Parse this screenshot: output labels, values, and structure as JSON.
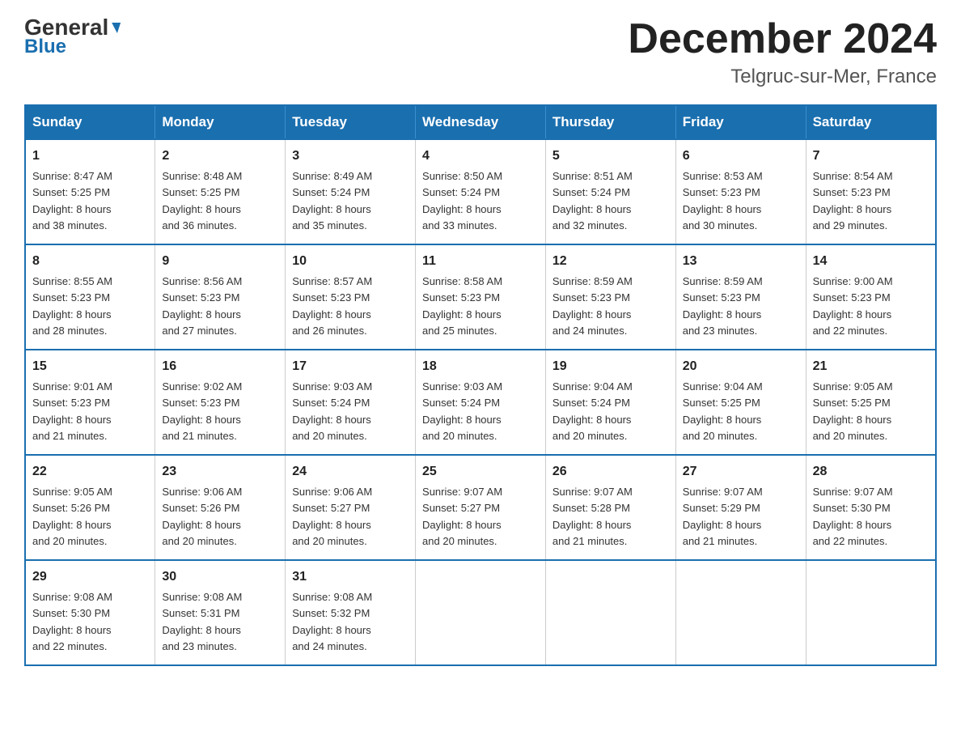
{
  "logo": {
    "part1": "General",
    "part2": "Blue"
  },
  "header": {
    "month_year": "December 2024",
    "location": "Telgruc-sur-Mer, France"
  },
  "days_of_week": [
    "Sunday",
    "Monday",
    "Tuesday",
    "Wednesday",
    "Thursday",
    "Friday",
    "Saturday"
  ],
  "weeks": [
    [
      {
        "day": "1",
        "sunrise": "8:47 AM",
        "sunset": "5:25 PM",
        "daylight": "8 hours and 38 minutes."
      },
      {
        "day": "2",
        "sunrise": "8:48 AM",
        "sunset": "5:25 PM",
        "daylight": "8 hours and 36 minutes."
      },
      {
        "day": "3",
        "sunrise": "8:49 AM",
        "sunset": "5:24 PM",
        "daylight": "8 hours and 35 minutes."
      },
      {
        "day": "4",
        "sunrise": "8:50 AM",
        "sunset": "5:24 PM",
        "daylight": "8 hours and 33 minutes."
      },
      {
        "day": "5",
        "sunrise": "8:51 AM",
        "sunset": "5:24 PM",
        "daylight": "8 hours and 32 minutes."
      },
      {
        "day": "6",
        "sunrise": "8:53 AM",
        "sunset": "5:23 PM",
        "daylight": "8 hours and 30 minutes."
      },
      {
        "day": "7",
        "sunrise": "8:54 AM",
        "sunset": "5:23 PM",
        "daylight": "8 hours and 29 minutes."
      }
    ],
    [
      {
        "day": "8",
        "sunrise": "8:55 AM",
        "sunset": "5:23 PM",
        "daylight": "8 hours and 28 minutes."
      },
      {
        "day": "9",
        "sunrise": "8:56 AM",
        "sunset": "5:23 PM",
        "daylight": "8 hours and 27 minutes."
      },
      {
        "day": "10",
        "sunrise": "8:57 AM",
        "sunset": "5:23 PM",
        "daylight": "8 hours and 26 minutes."
      },
      {
        "day": "11",
        "sunrise": "8:58 AM",
        "sunset": "5:23 PM",
        "daylight": "8 hours and 25 minutes."
      },
      {
        "day": "12",
        "sunrise": "8:59 AM",
        "sunset": "5:23 PM",
        "daylight": "8 hours and 24 minutes."
      },
      {
        "day": "13",
        "sunrise": "8:59 AM",
        "sunset": "5:23 PM",
        "daylight": "8 hours and 23 minutes."
      },
      {
        "day": "14",
        "sunrise": "9:00 AM",
        "sunset": "5:23 PM",
        "daylight": "8 hours and 22 minutes."
      }
    ],
    [
      {
        "day": "15",
        "sunrise": "9:01 AM",
        "sunset": "5:23 PM",
        "daylight": "8 hours and 21 minutes."
      },
      {
        "day": "16",
        "sunrise": "9:02 AM",
        "sunset": "5:23 PM",
        "daylight": "8 hours and 21 minutes."
      },
      {
        "day": "17",
        "sunrise": "9:03 AM",
        "sunset": "5:24 PM",
        "daylight": "8 hours and 20 minutes."
      },
      {
        "day": "18",
        "sunrise": "9:03 AM",
        "sunset": "5:24 PM",
        "daylight": "8 hours and 20 minutes."
      },
      {
        "day": "19",
        "sunrise": "9:04 AM",
        "sunset": "5:24 PM",
        "daylight": "8 hours and 20 minutes."
      },
      {
        "day": "20",
        "sunrise": "9:04 AM",
        "sunset": "5:25 PM",
        "daylight": "8 hours and 20 minutes."
      },
      {
        "day": "21",
        "sunrise": "9:05 AM",
        "sunset": "5:25 PM",
        "daylight": "8 hours and 20 minutes."
      }
    ],
    [
      {
        "day": "22",
        "sunrise": "9:05 AM",
        "sunset": "5:26 PM",
        "daylight": "8 hours and 20 minutes."
      },
      {
        "day": "23",
        "sunrise": "9:06 AM",
        "sunset": "5:26 PM",
        "daylight": "8 hours and 20 minutes."
      },
      {
        "day": "24",
        "sunrise": "9:06 AM",
        "sunset": "5:27 PM",
        "daylight": "8 hours and 20 minutes."
      },
      {
        "day": "25",
        "sunrise": "9:07 AM",
        "sunset": "5:27 PM",
        "daylight": "8 hours and 20 minutes."
      },
      {
        "day": "26",
        "sunrise": "9:07 AM",
        "sunset": "5:28 PM",
        "daylight": "8 hours and 21 minutes."
      },
      {
        "day": "27",
        "sunrise": "9:07 AM",
        "sunset": "5:29 PM",
        "daylight": "8 hours and 21 minutes."
      },
      {
        "day": "28",
        "sunrise": "9:07 AM",
        "sunset": "5:30 PM",
        "daylight": "8 hours and 22 minutes."
      }
    ],
    [
      {
        "day": "29",
        "sunrise": "9:08 AM",
        "sunset": "5:30 PM",
        "daylight": "8 hours and 22 minutes."
      },
      {
        "day": "30",
        "sunrise": "9:08 AM",
        "sunset": "5:31 PM",
        "daylight": "8 hours and 23 minutes."
      },
      {
        "day": "31",
        "sunrise": "9:08 AM",
        "sunset": "5:32 PM",
        "daylight": "8 hours and 24 minutes."
      },
      null,
      null,
      null,
      null
    ]
  ],
  "labels": {
    "sunrise": "Sunrise:",
    "sunset": "Sunset:",
    "daylight": "Daylight:"
  }
}
